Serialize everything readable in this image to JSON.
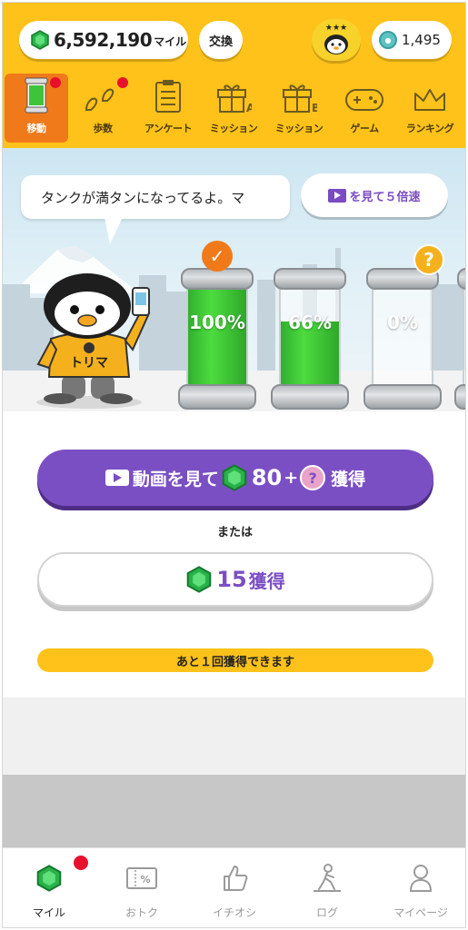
{
  "header": {
    "miles_value": "6,592,190",
    "miles_unit": "マイル",
    "exchange_label": "交換",
    "coin_value": "1,495"
  },
  "tabs": [
    {
      "label": "移動",
      "icon": "tank-icon",
      "active": true,
      "badge": true
    },
    {
      "label": "歩数",
      "icon": "footprints-icon",
      "active": false,
      "badge": true
    },
    {
      "label": "アンケート",
      "icon": "clipboard-icon",
      "active": false,
      "badge": false
    },
    {
      "label": "ミッション",
      "icon": "gift-a-icon",
      "active": false,
      "badge": false
    },
    {
      "label": "ミッション",
      "icon": "gift-b-icon",
      "active": false,
      "badge": false
    },
    {
      "label": "ゲーム",
      "icon": "gamepad-icon",
      "active": false,
      "badge": false
    },
    {
      "label": "ランキング",
      "icon": "crown-icon",
      "active": false,
      "badge": false
    }
  ],
  "scene": {
    "bubble_text": "タンクが満タンになってるよ。マ",
    "speed_button": "を見て５倍速",
    "mascot_shirt_text": "トリマ",
    "tanks": [
      {
        "percent_label": "100%",
        "fill": 1.0,
        "badge": "check-icon"
      },
      {
        "percent_label": "66%",
        "fill": 0.66,
        "badge": ""
      },
      {
        "percent_label": "0%",
        "fill": 0.0,
        "badge": "question-icon"
      }
    ]
  },
  "actions": {
    "watch_prefix": "動画を見て",
    "watch_amount": "80",
    "watch_plus": "+",
    "watch_suffix": "獲得",
    "or_text": "または",
    "plain_amount": "15",
    "plain_suffix": "獲得",
    "remaining_text": "あと１回獲得できます"
  },
  "bottom_nav": [
    {
      "label": "マイル",
      "icon": "gem-icon",
      "active": true,
      "badge": true
    },
    {
      "label": "おトク",
      "icon": "coupon-icon",
      "active": false,
      "badge": false
    },
    {
      "label": "イチオシ",
      "icon": "thumbs-up-icon",
      "active": false,
      "badge": false
    },
    {
      "label": "ログ",
      "icon": "walking-person-icon",
      "active": false,
      "badge": false
    },
    {
      "label": "マイページ",
      "icon": "person-icon",
      "active": false,
      "badge": false
    }
  ],
  "colors": {
    "header_yellow": "#ffc21a",
    "active_tab_orange": "#f07a1a",
    "purple": "#7b4fc4",
    "tank_green": "#3dc43a",
    "badge_red": "#e8112d"
  }
}
